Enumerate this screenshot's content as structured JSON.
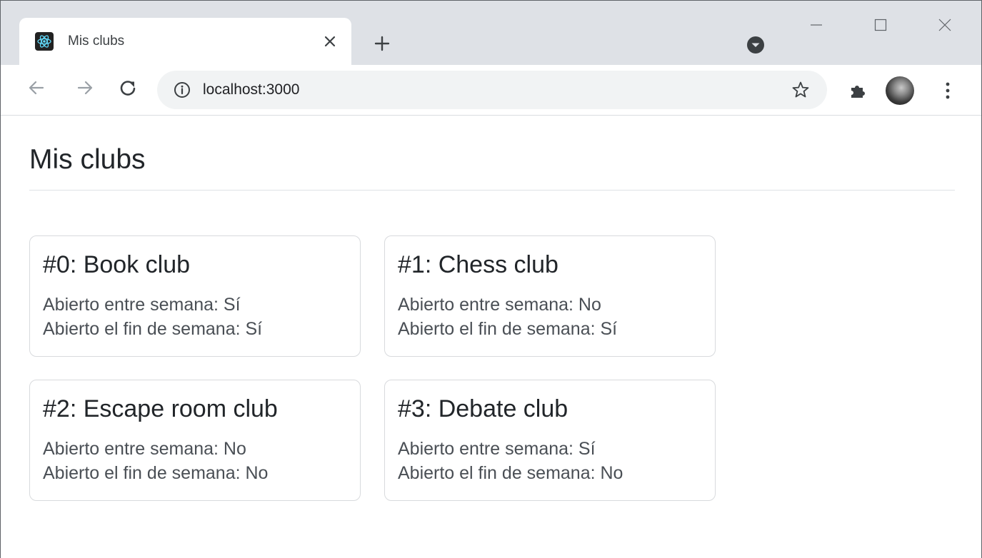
{
  "browser": {
    "tab": {
      "title": "Mis clubs",
      "favicon": "react-logo-icon",
      "close_icon": "close-icon"
    },
    "new_tab_icon": "plus-icon",
    "address_bar": {
      "url": "localhost:3000",
      "info_icon": "info-icon",
      "bookmark_icon": "star-icon"
    },
    "window_controls": [
      "minimize-icon",
      "maximize-icon",
      "close-icon"
    ],
    "toolbar_icons": [
      "back-arrow-icon",
      "forward-arrow-icon",
      "reload-icon",
      "puzzle-icon",
      "kebab-menu-icon"
    ]
  },
  "page": {
    "title": "Mis clubs",
    "clubs": [
      {
        "heading": "#0: Book club",
        "weekdays": "Abierto entre semana: Sí",
        "weekend": "Abierto el fin de semana: Sí"
      },
      {
        "heading": "#1: Chess club",
        "weekdays": "Abierto entre semana: No",
        "weekend": "Abierto el fin de semana: Sí"
      },
      {
        "heading": "#2: Escape room club",
        "weekdays": "Abierto entre semana: No",
        "weekend": "Abierto el fin de semana: No"
      },
      {
        "heading": "#3: Debate club",
        "weekdays": "Abierto entre semana: Sí",
        "weekend": "Abierto el fin de semana: No"
      }
    ]
  },
  "colors": {
    "tabstrip_bg": "#dee1e6",
    "omnibox_bg": "#f1f3f4",
    "text_primary": "#212529",
    "card_border": "#d8dadd",
    "favicon_accent": "#61dafb"
  }
}
